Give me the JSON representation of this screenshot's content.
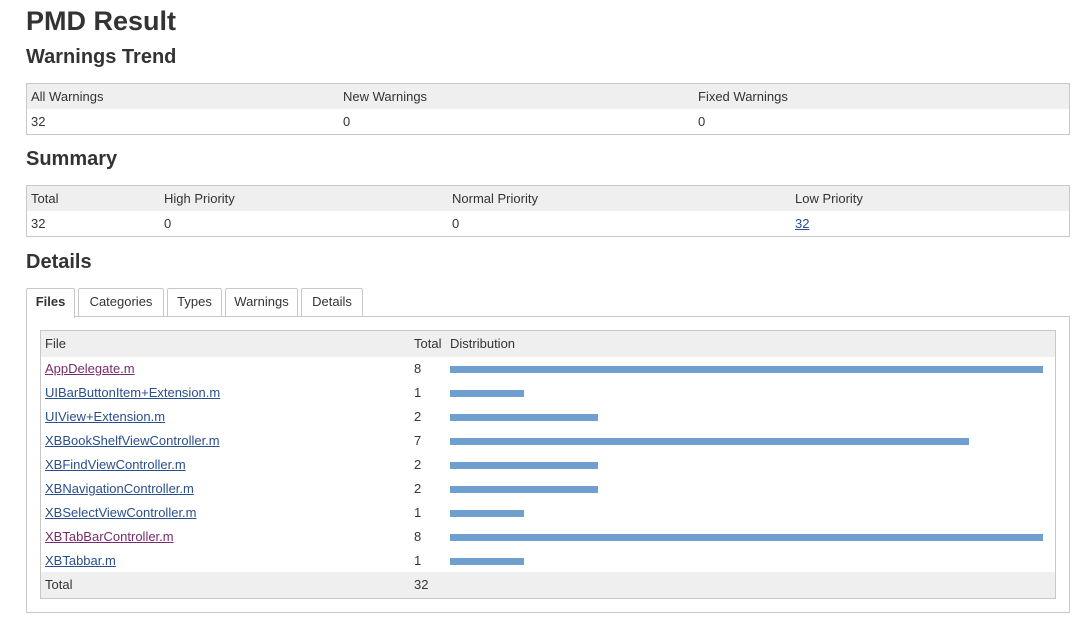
{
  "page": {
    "title": "PMD Result"
  },
  "trend": {
    "heading": "Warnings Trend",
    "headers": [
      "All Warnings",
      "New Warnings",
      "Fixed Warnings"
    ],
    "values": [
      "32",
      "0",
      "0"
    ]
  },
  "summary": {
    "heading": "Summary",
    "headers": [
      "Total",
      "High Priority",
      "Normal Priority",
      "Low Priority"
    ],
    "values": [
      "32",
      "0",
      "0",
      "32"
    ]
  },
  "details": {
    "heading": "Details",
    "tabs": [
      "Files",
      "Categories",
      "Types",
      "Warnings",
      "Details"
    ],
    "active_tab": "Files",
    "table": {
      "headers": [
        "File",
        "Total",
        "Distribution"
      ],
      "max_value": 8,
      "rows": [
        {
          "file": "AppDelegate.m",
          "total": 8,
          "visited": true
        },
        {
          "file": "UIBarButtonItem+Extension.m",
          "total": 1,
          "visited": false
        },
        {
          "file": "UIView+Extension.m",
          "total": 2,
          "visited": false
        },
        {
          "file": "XBBookShelfViewController.m",
          "total": 7,
          "visited": false
        },
        {
          "file": "XBFindViewController.m",
          "total": 2,
          "visited": false
        },
        {
          "file": "XBNavigationController.m",
          "total": 2,
          "visited": false
        },
        {
          "file": "XBSelectViewController.m",
          "total": 1,
          "visited": false
        },
        {
          "file": "XBTabBarController.m",
          "total": 8,
          "visited": true
        },
        {
          "file": "XBTabbar.m",
          "total": 1,
          "visited": false
        }
      ],
      "footer": {
        "label": "Total",
        "total": "32"
      }
    }
  },
  "colors": {
    "bar": "#6f9fce",
    "link": "#2a4f8f",
    "visited_link": "#7a2a6e",
    "header_bg": "#efefef"
  }
}
